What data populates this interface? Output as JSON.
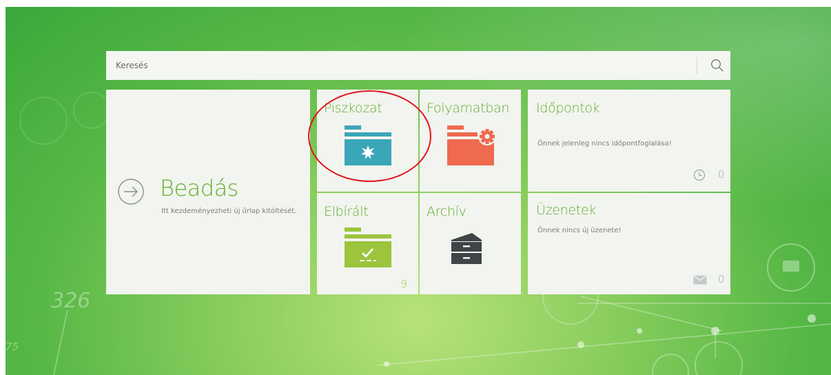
{
  "search": {
    "placeholder": "Keresés",
    "icon": "search-icon"
  },
  "beadas": {
    "title": "Beadás",
    "description": "Itt kezdeményezheti új űrlap kitöltését.",
    "icon": "arrow-right-circle-icon"
  },
  "tiles": {
    "piszkozat": {
      "title": "Piszkozat",
      "icon": "draft-folder-icon",
      "color": "#3aa6b8"
    },
    "folyamatban": {
      "title": "Folyamatban",
      "icon": "folder-gear-icon",
      "color": "#ef6a4f"
    },
    "elbiralt": {
      "title": "Elbírált",
      "icon": "folder-check-icon",
      "color": "#9cc43d",
      "count": "9"
    },
    "archiv": {
      "title": "Archív",
      "icon": "archive-cabinet-icon",
      "color": "#3f4447"
    }
  },
  "idopontok": {
    "title": "Időpontok",
    "message": "Önnek jelenleg nincs időpontfoglalása!",
    "count": "0",
    "icon": "clock-icon"
  },
  "uzenetek": {
    "title": "Üzenetek",
    "message": "Önnek nincs új üzenete!",
    "count": "0",
    "icon": "envelope-icon"
  },
  "background": {
    "numbers": [
      "326",
      "75"
    ]
  },
  "colors": {
    "accent_green": "#5fae2c",
    "annotation_red": "#e2141b"
  }
}
